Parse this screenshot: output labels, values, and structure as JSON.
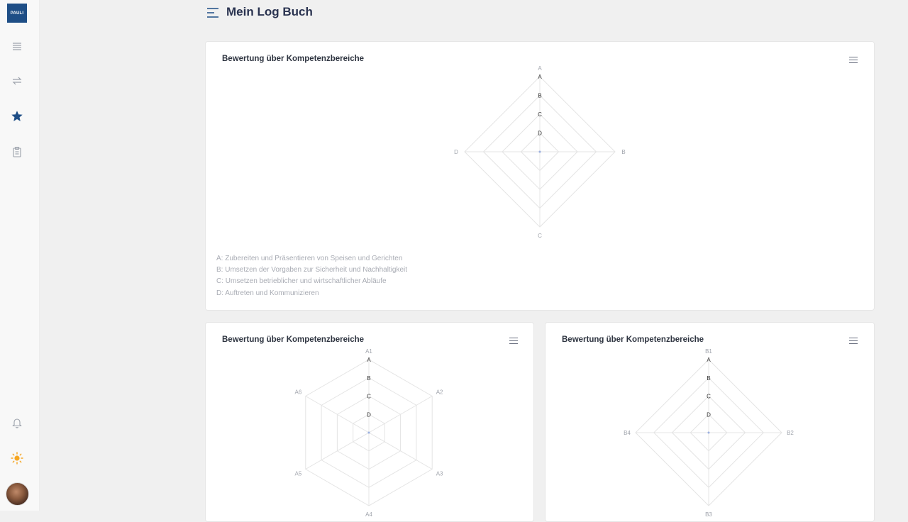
{
  "app": {
    "logo_text": "PAULI",
    "page_title": "Mein Log Buch"
  },
  "sidebar": {
    "items": [
      {
        "icon": "list-icon"
      },
      {
        "icon": "repeat-icon"
      },
      {
        "icon": "star-icon"
      },
      {
        "icon": "clipboard-icon"
      }
    ],
    "bottom": [
      {
        "icon": "bell-icon"
      },
      {
        "icon": "sun-icon"
      },
      {
        "icon": "avatar"
      }
    ]
  },
  "colors": {
    "accent": "#1e4e86",
    "sun": "#f5a623",
    "grid": "#e4e4e4"
  },
  "cards": [
    {
      "title": "Bewertung über Kompetenzbereiche",
      "axes": [
        "A",
        "B",
        "C",
        "D"
      ],
      "scale_labels": [
        "A",
        "B",
        "C",
        "D"
      ],
      "legend": [
        "A: Zubereiten und Präsentieren von Speisen und Gerichten",
        "B: Umsetzen der Vorgaben zur Sicherheit und Nachhaltigkeit",
        "C: Umsetzen betrieblicher und wirtschaftlicher Abläufe",
        "D: Auftreten und Kommunizieren"
      ]
    },
    {
      "title": "Bewertung über Kompetenzbereiche",
      "axes": [
        "A1",
        "A2",
        "A3",
        "A4",
        "A5",
        "A6"
      ],
      "scale_labels": [
        "A",
        "B",
        "C",
        "D"
      ]
    },
    {
      "title": "Bewertung über Kompetenzbereiche",
      "axes": [
        "B1",
        "B2",
        "B3",
        "B4"
      ],
      "scale_labels": [
        "A",
        "B",
        "C",
        "D"
      ]
    }
  ]
}
